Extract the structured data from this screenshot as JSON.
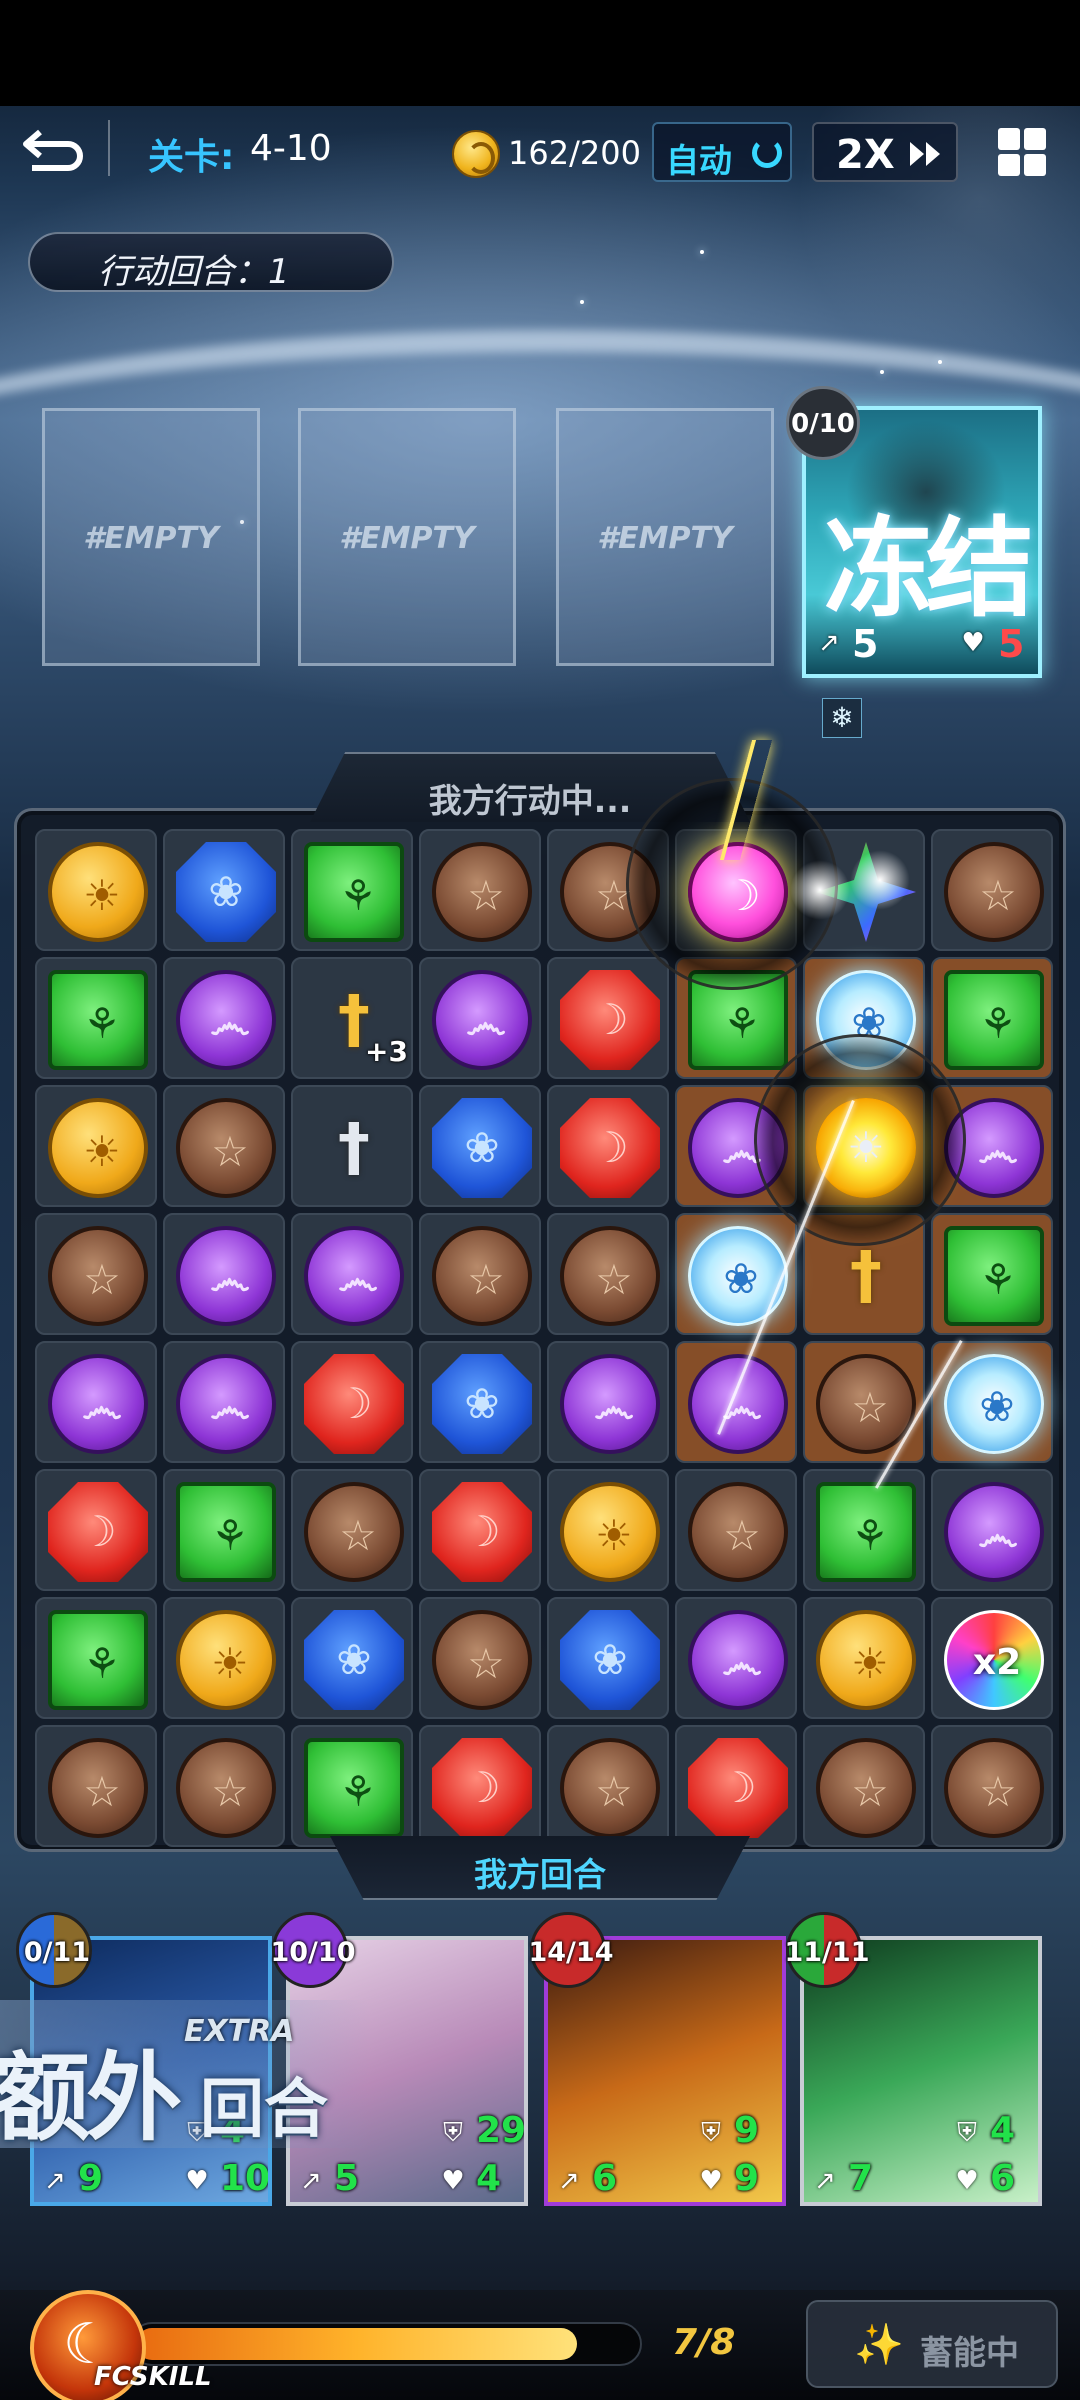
{
  "hud": {
    "stage_label": "关卡:",
    "stage_value": "4-10",
    "coins": "162/200",
    "auto_label": "自动",
    "speed_label": "2X"
  },
  "turn": {
    "label": "行动回合：1"
  },
  "enemy_slots": [
    "#EMPTY",
    "#EMPTY",
    "#EMPTY"
  ],
  "enemy": {
    "counter": "0/10",
    "name": "冻结",
    "speed": "5",
    "hp": "5",
    "status_icon": "snowflake-icon"
  },
  "board": {
    "header": "我方行动中...",
    "footer": "我方回合",
    "grid": [
      [
        "yellow",
        "blue",
        "green",
        "brown",
        "brown",
        "pink",
        "star",
        "brown"
      ],
      [
        "green",
        "purple",
        "sword-gold",
        "purple",
        "red",
        "green",
        "ice",
        "green"
      ],
      [
        "yellow",
        "brown",
        "sword-silver",
        "blue",
        "red",
        "purple",
        "sun",
        "purple"
      ],
      [
        "brown",
        "purple",
        "purple",
        "brown",
        "brown",
        "ice",
        "sword-gold-small",
        "green"
      ],
      [
        "purple",
        "purple",
        "red",
        "blue",
        "purple",
        "purple",
        "brown",
        "ice"
      ],
      [
        "red",
        "green",
        "brown",
        "red",
        "yellow",
        "brown",
        "green",
        "purple"
      ],
      [
        "green",
        "yellow",
        "blue",
        "brown",
        "blue",
        "purple",
        "yellow",
        "rainbow"
      ],
      [
        "brown",
        "brown",
        "green",
        "red",
        "brown",
        "red",
        "brown",
        "brown"
      ]
    ],
    "sword_bonus": "+3",
    "rainbow_label": "x2"
  },
  "heroes": [
    {
      "counter": "0/11",
      "attack": "9",
      "hp": "10",
      "defense": "4",
      "border": "#4aa8e8",
      "art": [
        "#0d2a5c",
        "#2a5aa8",
        "#6ea8e0"
      ]
    },
    {
      "counter": "10/10",
      "attack": "5",
      "hp": "4",
      "defense": "29",
      "border": "#c8ccd4",
      "art": [
        "#e6d2e6",
        "#b88ab8",
        "#5a6a8a"
      ]
    },
    {
      "counter": "14/14",
      "attack": "6",
      "hp": "9",
      "defense": "9",
      "border": "#a03cd8",
      "art": [
        "#3a1a10",
        "#c86a18",
        "#f2c84a"
      ]
    },
    {
      "counter": "11/11",
      "attack": "7",
      "hp": "6",
      "defense": "4",
      "border": "#c8ccd4",
      "art": [
        "#0e3a1e",
        "#3aa858",
        "#c8f0c8"
      ]
    }
  ],
  "extra_turn": {
    "small": "EXTRA",
    "big1": "额外",
    "big2": "回合"
  },
  "footer": {
    "skill_label": "FCSKILL",
    "energy_text": "7/8",
    "energy_fraction": 0.875,
    "charge_label": "蓄能中"
  }
}
